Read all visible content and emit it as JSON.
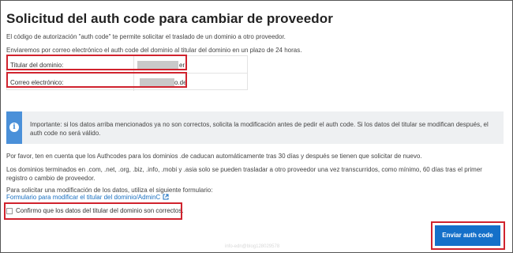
{
  "page": {
    "title": "Solicitud del auth code para cambiar de proveedor",
    "intro_line1": "El código de autorización \"auth code\" te permite solicitar el traslado de un dominio a otro proveedor.",
    "intro_line2": "Enviaremos por correo electrónico el auth code del dominio al titular del dominio en un plazo de 24 horas."
  },
  "domain_info": {
    "holder_label": "Titular del dominio:",
    "holder_value_suffix": "er",
    "email_label": "Correo electrónico:",
    "email_value_suffix": "o.de"
  },
  "notice": {
    "icon": "info-icon",
    "text": "Importante: si los datos arriba mencionados ya no son correctos, solicita la modificación antes de pedir el auth code. Si los datos del titular se modifican después, el auth code no será válido."
  },
  "body": {
    "paragraph1": "Por favor, ten en cuenta que los Authcodes para los dominios .de caducan automáticamente tras 30 días y después se tienen que solicitar de nuevo.",
    "paragraph2": "Los dominios terminados en .com, .net, .org, .biz, .info, .mobi y .asia solo se pueden trasladar a otro proveedor una vez transcurridos, como mínimo, 60 días tras el primer registro o cambio de proveedor.",
    "paragraph3": "Para solicitar una modificación de los datos, utiliza el siguiente formulario:",
    "form_link": "Formulario para modificar el titular del dominio/AdminC"
  },
  "confirm": {
    "label": "Confirmo que los datos del titular del dominio son correctos.",
    "checked": false
  },
  "actions": {
    "submit_label": "Enviar auth code"
  },
  "footer": {
    "watermark": "info-edn@blog128029578"
  },
  "colors": {
    "accent": "#1570c9",
    "highlight": "#d0232e",
    "notice_bar": "#4a90d9"
  }
}
